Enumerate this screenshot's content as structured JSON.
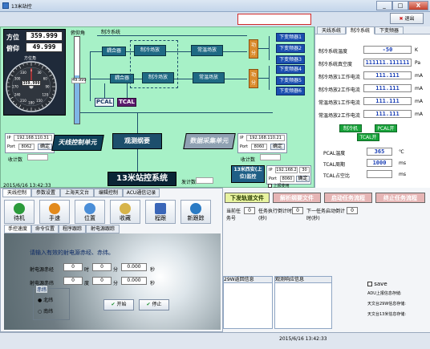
{
  "window": {
    "title": "13米站控",
    "min": "_",
    "max": "□",
    "close": "X"
  },
  "topbar": {
    "exit_label": "退出"
  },
  "left_panel": {
    "azimuth_label": "方位",
    "azimuth_value": "359.999",
    "elevation_label": "俯仰",
    "elevation_value": "49.999",
    "dial_caption": "方位角",
    "dial_value": "359.999",
    "dial_ticks": [
      "0",
      "30",
      "60",
      "90",
      "120",
      "150",
      "180",
      "210",
      "240",
      "270",
      "300",
      "330"
    ],
    "bar_caption": "俯仰角",
    "bar_value": "49.999"
  },
  "diagram": {
    "title": "制冷系统",
    "row1": [
      "耦合器",
      "制冷场放",
      "常温场放"
    ],
    "row2": [
      "耦合器",
      "制冷场放",
      "常温场放"
    ],
    "gongfen": "功分",
    "downconverters": [
      "下变频器1",
      "下变频器2",
      "下变频器3",
      "下变频器4",
      "下变频器5",
      "下变频器6"
    ],
    "pcal": "PCAL",
    "tcal": "TCAL",
    "antenna_ctrl": "天线控制单元",
    "obs_box": "观测纲要",
    "data_acq": "数据采集单元",
    "station_title": "13米站控系统",
    "remote_unit": "13米西安(上位)监控",
    "ip_label": "IP",
    "port_label": "Port",
    "ip_a": "192.168.110.31",
    "port_a": "8062",
    "ok_a": "确定",
    "recv_a": "收计数",
    "ip_b": "192.168.110.21",
    "port_b": "8060",
    "ok_b": "确定",
    "recv_b": "收计数",
    "ip_c": "192.168.2",
    "ip_c2": "30",
    "port_c": "8060",
    "ok_c": "确定",
    "upload": "上报使用",
    "send_label": "发计数",
    "datetime": "2015/6/16 13:42:33"
  },
  "right_panel": {
    "tabs": [
      "天线系统",
      "制冷系统",
      "下变频器"
    ],
    "rows": [
      {
        "label": "制冷系统温度",
        "value": "-50",
        "unit": "K"
      },
      {
        "label": "制冷系统真空度",
        "value": "111111.111111",
        "unit": "Pa"
      },
      {
        "label": "制冷场放1工作电流",
        "value": "111.111",
        "unit": "mA"
      },
      {
        "label": "制冷场放2工作电流",
        "value": "111.111",
        "unit": "mA"
      },
      {
        "label": "常温场放1工作电流",
        "value": "111.111",
        "unit": "mA"
      },
      {
        "label": "常温场放2工作电流",
        "value": "111.111",
        "unit": "mA"
      }
    ],
    "btn_refrig": "制冷机",
    "btn_pcal": "PCAL开",
    "btn_tcal": "TCAL开",
    "pcal_temp_label": "PCAL温度",
    "pcal_temp": "365",
    "pcal_temp_unit": "℃",
    "tcal_period_label": "TCAL周期",
    "tcal_period": "1000",
    "tcal_period_unit": "ms",
    "tcal_duty_label": "TCAL占空比",
    "tcal_duty": "",
    "tcal_duty_unit": "ms"
  },
  "control": {
    "tabs": [
      "天线控制",
      "参数设置",
      "上海天文台",
      "编辑控制",
      "ACU通信记录"
    ],
    "icons": [
      "待机",
      "手速",
      "位置",
      "收藏",
      "程跟",
      "新跟踪"
    ],
    "subtabs": [
      "手控速度",
      "命令位置",
      "程序跟踪",
      "射电源跟踪"
    ],
    "prompt": "请输入有效的射电源赤经、赤纬。",
    "ra_label": "射电源赤经",
    "dec_label": "射电源赤纬",
    "ra": [
      "0",
      "0",
      "0.000"
    ],
    "ra_units": [
      "时",
      "分",
      "秒"
    ],
    "dec": [
      "0",
      "0",
      "0.000"
    ],
    "dec_units": [
      "度",
      "分",
      "秒"
    ],
    "dec_group": "赤纬",
    "north": "北纬",
    "south": "南纬",
    "start": "开始",
    "stop": "停止"
  },
  "middle": {
    "buttons": [
      "下发轨道文件",
      "解析纲要文件",
      "启动任务流程",
      "终止任务流程"
    ],
    "cols": [
      "当前任务号",
      "任务执行倒计时(秒)",
      "下一任务启动倒计时(秒)"
    ],
    "zero": "0",
    "grid1": "29W返回信息",
    "grid2": "观测响应信息",
    "save": "save",
    "logs": [
      "ADU上报信息存储:",
      "天文台29W信息存储:",
      "天文台13米信息存储:"
    ]
  },
  "status": {
    "datetime": "2015/6/16 13:42:33"
  }
}
